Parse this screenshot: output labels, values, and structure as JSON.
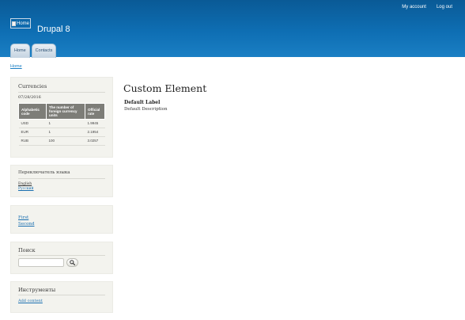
{
  "header": {
    "secondary_menu": [
      "My account",
      "Log out"
    ],
    "logo_alt": "Home",
    "site_name": "Drupal 8",
    "tabs": [
      "Home",
      "Contacts"
    ],
    "colors": {
      "header_top": "#0a5a96",
      "header_bottom": "#1a7fc4",
      "link": "#1a6fb0"
    }
  },
  "breadcrumb": "Home",
  "sidebar": {
    "currencies": {
      "title": "Currencies",
      "date": "07/28/2016",
      "columns": [
        "Alphabetic code",
        "The number of foreign currency units",
        "Official rate"
      ],
      "rows": [
        [
          "USD",
          "1",
          "1.9945"
        ],
        [
          "EUR",
          "1",
          "2.1954"
        ],
        [
          "RUB",
          "100",
          "3.0257"
        ]
      ]
    },
    "language_switcher": {
      "title": "Переключатель языка",
      "items": [
        "English",
        "Русский"
      ]
    },
    "menu": {
      "items": [
        "First",
        "Second"
      ]
    },
    "search": {
      "title": "Поиск",
      "value": "",
      "button_icon": "search-icon"
    },
    "tools": {
      "title": "Инструменты",
      "link": "Add content"
    }
  },
  "main": {
    "title": "Custom Element",
    "label": "Default Label",
    "description": "Default Description"
  }
}
